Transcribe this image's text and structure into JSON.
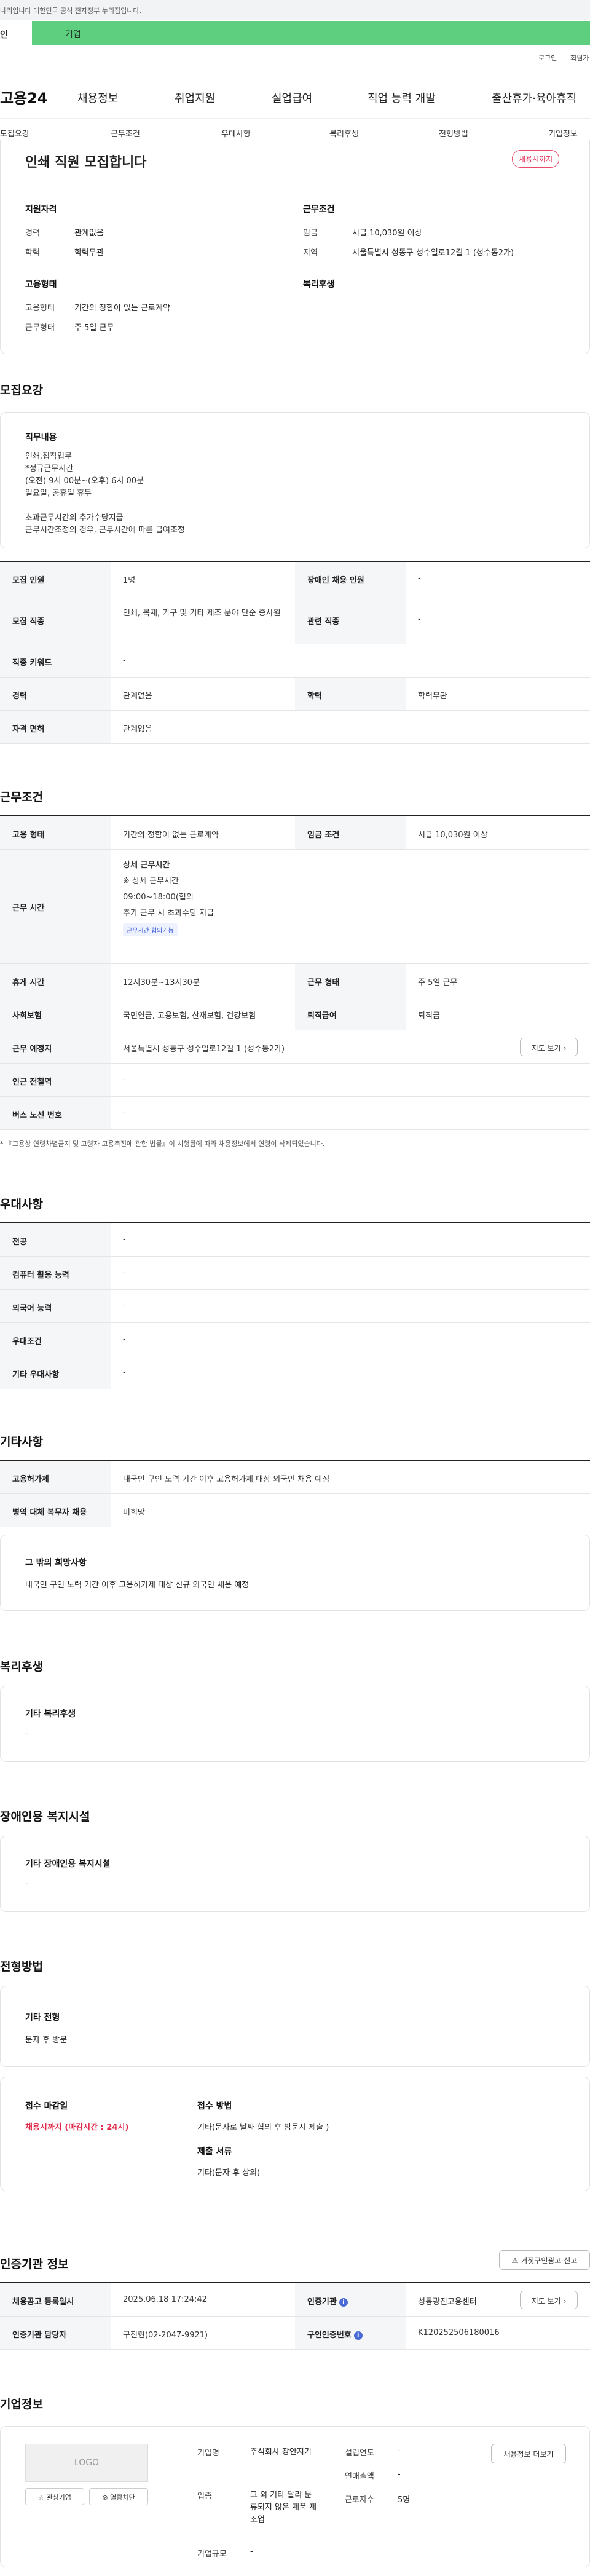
{
  "gov_notice": "나리입니다 대한민국 공식 전자정부 누리집입니다.",
  "user_tabs": {
    "person": "인",
    "company": "기업"
  },
  "util": {
    "login": "로그인",
    "join": "회원가"
  },
  "gnb": {
    "logo": "고용24",
    "menu": [
      "채용정보",
      "취업지원",
      "실업급여",
      "직업 능력 개발",
      "출산휴가·육아휴직"
    ]
  },
  "subnav": [
    "모집요강",
    "근무조건",
    "우대사항",
    "복리후생",
    "전형방법",
    "기업정보"
  ],
  "summary": {
    "title": "인쇄 직원 모집합니다",
    "badge": "채용시까지",
    "qual_title": "지원자격",
    "career_label": "경력",
    "career_value": "관계없음",
    "edu_label": "학력",
    "edu_value": "학력무관",
    "cond_title": "근무조건",
    "wage_label": "임금",
    "wage_value": "시급 10,030원 이상",
    "area_label": "지역",
    "area_value": "서울특별시 성동구 성수일로12길 1 (성수동2가)",
    "emp_title": "고용형태",
    "emp_type_label": "고용형태",
    "emp_type_value": "기간의 정함이 없는 근로계약",
    "work_form_label": "근무형태",
    "work_form_value": "주 5일 근무",
    "welfare_title": "복리후생"
  },
  "recruit": {
    "section_title": "모집요강",
    "job_title": "직무내용",
    "job_text": "인쇄,접착업무\n*정규근무시간\n(오전) 9시 00분~(오후) 6시 00분\n일요일, 공휴일 휴무\n\n초과근무시간의 추가수당지급\n근무시간조정의 경우, 근무시간에 따른 급여조정",
    "rows": [
      {
        "l1": "모집 인원",
        "v1": "1명",
        "l2": "장애인 채용 인원",
        "v2": "-"
      },
      {
        "l1": "모집 직종",
        "v1": "인쇄, 목재, 가구 및 기타 제조 분야 단순 종사원",
        "l2": "관련 직종",
        "v2": "-"
      },
      {
        "l1": "직종 키워드",
        "v1": "-"
      },
      {
        "l1": "경력",
        "v1": "관계없음",
        "l2": "학력",
        "v2": "학력무관"
      },
      {
        "l1": "자격 면허",
        "v1": "관계없음"
      }
    ]
  },
  "work": {
    "section_title": "근무조건",
    "emp_label": "고용 형태",
    "emp_value": "기간의 정함이 없는 근로계약",
    "wage_label": "임금 조건",
    "wage_value": "시급 10,030원 이상",
    "hours_label": "근무 시간",
    "hours_head": "상세 근무시간",
    "hours_sub": "※ 상세 근무시간",
    "hours_time": "09:00~18:00(협의",
    "hours_extra": "추가 근무 시 초과수당 지급",
    "hours_tag": "근무시간 협의가능",
    "break_label": "휴게 시간",
    "break_value": "12시30분~13시30분",
    "form_label": "근무 형태",
    "form_value": "주 5일 근무",
    "ins_label": "사회보험",
    "ins_value": "국민연금, 고용보험, 산재보험, 건강보험",
    "ret_label": "퇴직급여",
    "ret_value": "퇴직금",
    "place_label": "근무 예정지",
    "place_value": "서울특별시 성동구 성수일로12길 1 (성수동2가)",
    "map_btn": "지도 보기",
    "subway_label": "인근 전철역",
    "subway_value": "-",
    "bus_label": "버스 노선 번호",
    "bus_value": "-",
    "note": "* 『고용상 연령차별금지 및 고령자 고용촉진에 관한 법률』이 시행됨에 따라 채용정보에서 연령이 삭제되었습니다."
  },
  "pref": {
    "section_title": "우대사항",
    "rows": [
      {
        "l": "전공",
        "v": "-"
      },
      {
        "l": "컴퓨터 활용 능력",
        "v": "-"
      },
      {
        "l": "외국어 능력",
        "v": "-"
      },
      {
        "l": "우대조건",
        "v": "-"
      },
      {
        "l": "기타 우대사항",
        "v": "-"
      }
    ]
  },
  "etc": {
    "section_title": "기타사항",
    "foreign_label": "고용허가제",
    "foreign_value": "내국인 구인 노력 기간 이후 고용허가제 대상 외국인 채용 예정",
    "military_label": "병역 대체 복무자 채용",
    "military_value": "비희망",
    "other_title": "그 밖의 희망사항",
    "other_text": "내국인 구인 노력 기간 이후 고용허가제 대상 신규 외국인 채용 예정"
  },
  "welfare": {
    "section_title": "복리후생",
    "box_title": "기타 복리후생",
    "box_value": "-"
  },
  "disabled": {
    "section_title": "장애인용 복지시설",
    "box_title": "기타 장애인용 복지시설",
    "box_value": "-"
  },
  "process": {
    "section_title": "전형방법",
    "box_title": "기타 전형",
    "box_value": "문자 후 방문",
    "deadline_label": "접수 마감일",
    "deadline_value": "채용시까지 (마감시간 : 24시)",
    "method_label": "접수 방법",
    "method_value": "기타(문자로 날짜 협의 후 방문시 제출 )",
    "docs_label": "제출 서류",
    "docs_value": "기타(문자 후 상의)"
  },
  "cert": {
    "section_title": "인증기관 정보",
    "report_btn": "거짓구인광고 신고",
    "reg_label": "채용공고 등록일시",
    "reg_value": "2025.06.18 17:24:42",
    "org_label": "인증기관",
    "org_value": "성동광진고용센터",
    "map_btn": "지도 보기",
    "mgr_label": "인증기관 담당자",
    "mgr_value": "구진현(02-2047-9921)",
    "num_label": "구인인증번호",
    "num_value": "K120252506180016"
  },
  "company": {
    "section_title": "기업정보",
    "logo": "LOGO",
    "fav_btn": "관심기업",
    "block_btn": "열람차단",
    "name_label": "기업명",
    "name_value": "주식회사 장안지기",
    "biz_label": "업종",
    "biz_value": "그 외 기타 달리 분류되지 않은 제품 제조업",
    "size_label": "기업규모",
    "size_value": "-",
    "year_label": "설립연도",
    "year_value": "-",
    "sales_label": "연매출액",
    "sales_value": "-",
    "emp_label": "근로자수",
    "emp_value": "5명",
    "more_btn": "채용정보 더보기"
  }
}
